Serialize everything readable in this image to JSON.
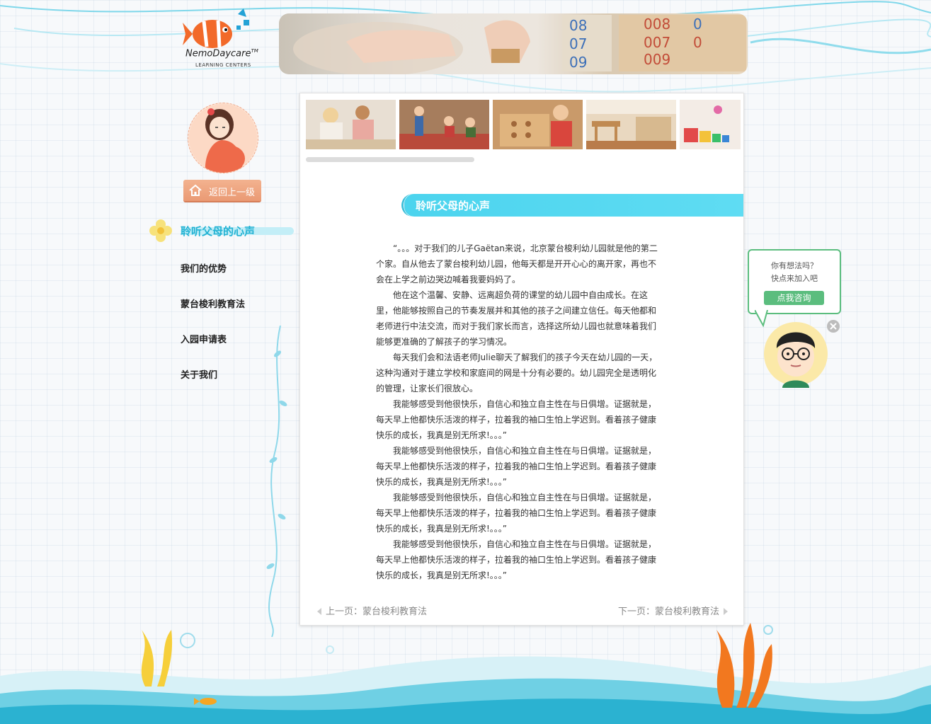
{
  "logo": {
    "brand": "NemoDaycare",
    "tm": "TM",
    "subtitle": "LEARNING CENTERS"
  },
  "sidebar": {
    "back_label": "返回上一级",
    "active_item": "聆听父母的心声",
    "items": [
      "我们的优势",
      "蒙台梭利教育法",
      "入园申请表",
      "关于我们"
    ]
  },
  "gallery": {
    "thumbnails": [
      "classroom-photo-1",
      "classroom-photo-2",
      "classroom-photo-3",
      "classroom-photo-4",
      "classroom-photo-5"
    ]
  },
  "article": {
    "title": "聆听父母的心声",
    "paragraphs": [
      "“。。。对于我们的儿子Gaëtan来说，北京蒙台梭利幼儿园就是他的第二个家。自从他去了蒙台梭利幼儿园，他每天都是开开心心的离开家，再也不会在上学之前边哭边喊着我要妈妈了。",
      "他在这个温馨、安静、远离超负荷的课堂的幼儿园中自由成长。在这里，他能够按照自己的节奏发展并和其他的孩子之间建立信任。每天他都和老师进行中法交流，而对于我们家长而言，选择这所幼儿园也就意味着我们能够更准确的了解孩子的学习情况。",
      "每天我们会和法语老师Julie聊天了解我们的孩子今天在幼儿园的一天，这种沟通对于建立学校和家庭间的网是十分有必要的。幼儿园完全是透明化的管理，让家长们很放心。",
      "我能够感受到他很快乐，自信心和独立自主性在与日俱增。证据就是，每天早上他都快乐活泼的样子，拉着我的袖口生怕上学迟到。看着孩子健康快乐的成长，我真是别无所求!。。。”",
      "我能够感受到他很快乐，自信心和独立自主性在与日俱增。证据就是，每天早上他都快乐活泼的样子，拉着我的袖口生怕上学迟到。看着孩子健康快乐的成长，我真是别无所求!。。。”",
      "我能够感受到他很快乐，自信心和独立自主性在与日俱增。证据就是，每天早上他都快乐活泼的样子，拉着我的袖口生怕上学迟到。看着孩子健康快乐的成长，我真是别无所求!。。。”",
      "我能够感受到他很快乐，自信心和独立自主性在与日俱增。证据就是，每天早上他都快乐活泼的样子，拉着我的袖口生怕上学迟到。看着孩子健康快乐的成长，我真是别无所求!。。。”"
    ]
  },
  "pager": {
    "prev": "上一页：蒙台梭利教育法",
    "next": "下一页：蒙台梭利教育法"
  },
  "consult": {
    "line1": "你有想法吗？",
    "line2": "快点来加入吧",
    "button": "点我咨询"
  },
  "colors": {
    "accent": "#4cd4ee",
    "nav_active": "#23b2d3",
    "back_button": "#ea9a74",
    "consult_green": "#5bbd7e"
  }
}
